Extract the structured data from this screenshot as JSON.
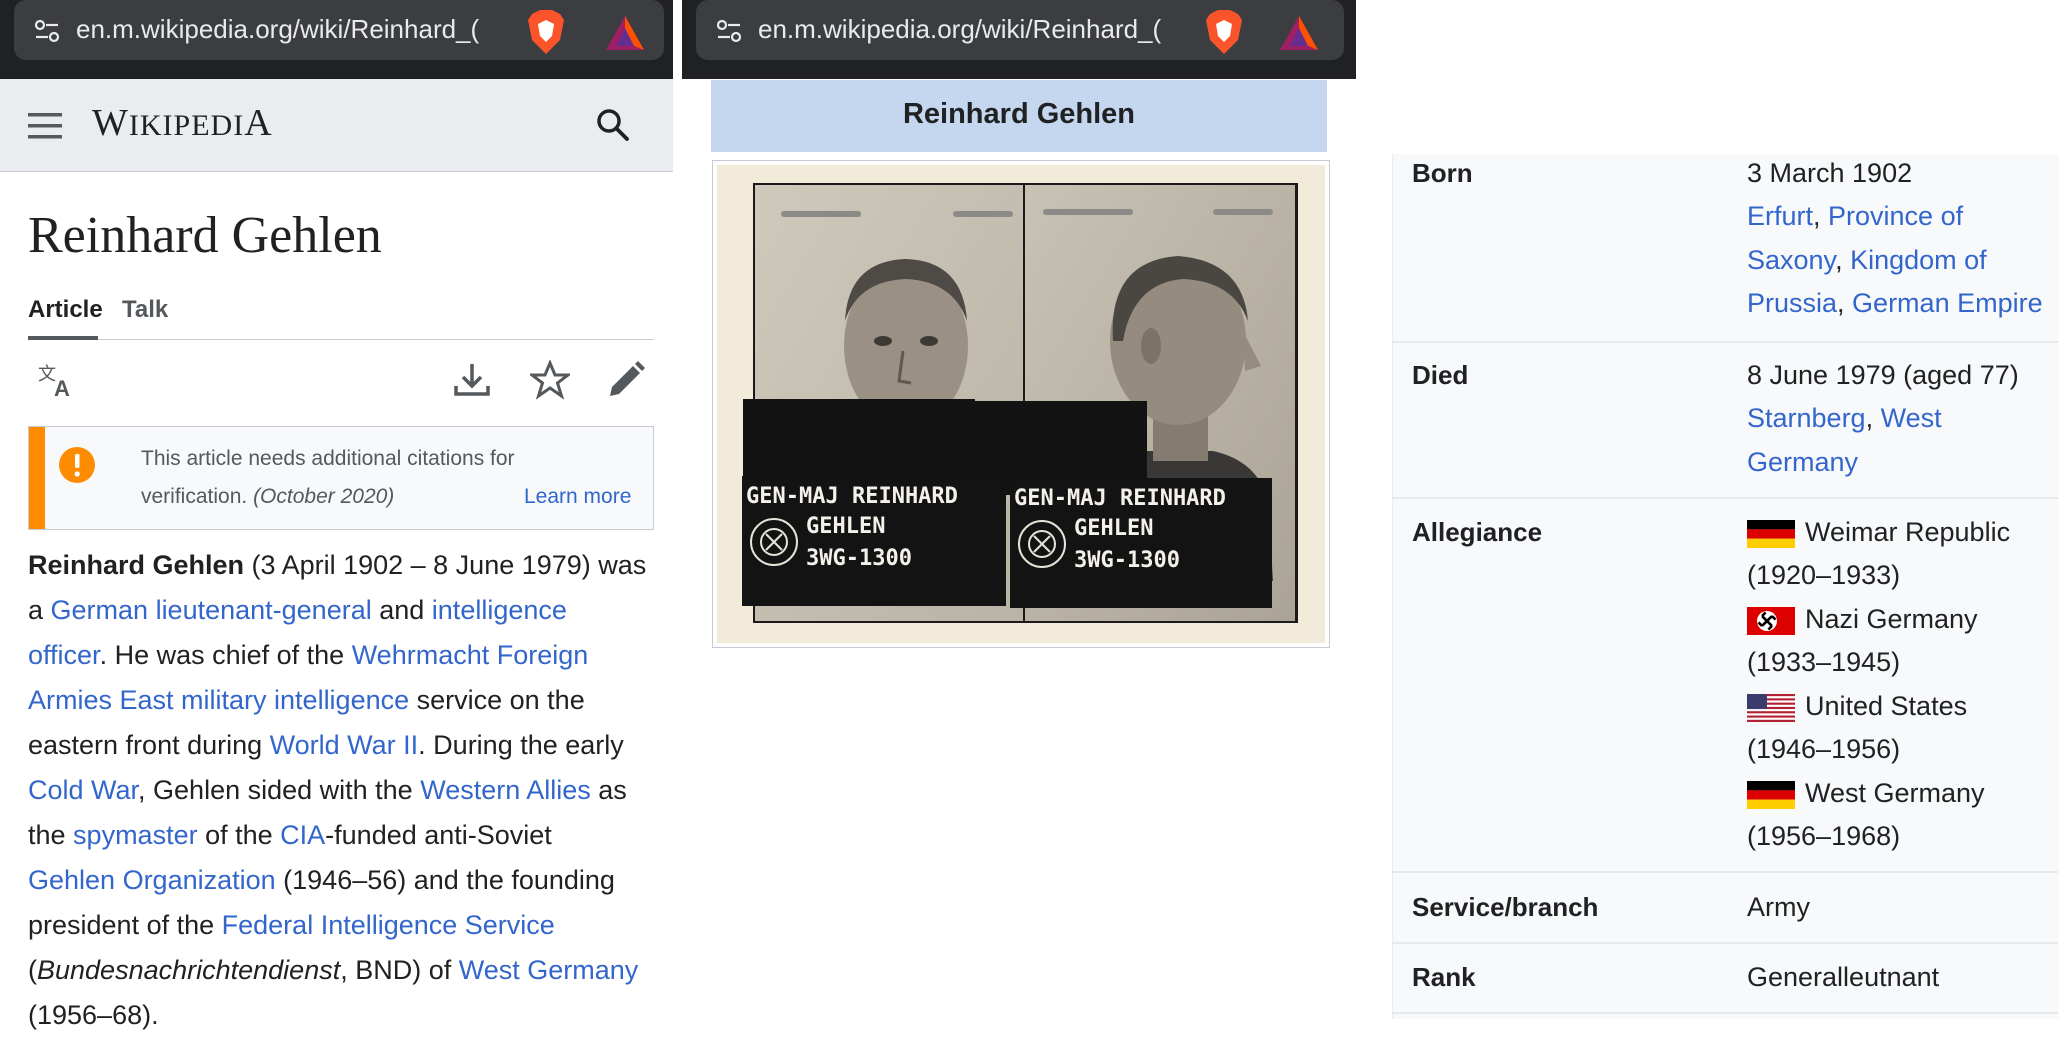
{
  "browser": {
    "url_left": "en.m.wikipedia.org/wiki/Reinhard_(",
    "url_mid": "en.m.wikipedia.org/wiki/Reinhard_("
  },
  "header": {
    "logo_big_w": "W",
    "logo_small_1": "IKIPEDI",
    "logo_big_a": "A"
  },
  "article": {
    "title": "Reinhard Gehlen",
    "tabs": [
      "Article",
      "Talk"
    ]
  },
  "notice": {
    "line1": "This article needs additional citations for",
    "line2_text": "verification.",
    "line2_date": "(October 2020)",
    "learn_more": "Learn more"
  },
  "lead": {
    "l1_bold": "Reinhard Gehlen",
    "l1_rest": " (3 April 1902 – 8 June 1979) was",
    "l2_a": "a ",
    "l2_link1": "German lieutenant-general",
    "l2_b": " and ",
    "l2_link2": "intelligence",
    "l3_link": "officer",
    "l3_b": ". He was chief of the ",
    "l3_link2": "Wehrmacht Foreign",
    "l4_link": "Armies East military intelligence",
    "l4_b": " service on the",
    "l5_a": "eastern front during ",
    "l5_link": "World War II",
    "l5_b": ". During the early",
    "l6_link": "Cold War",
    "l6_b": ", Gehlen sided with the ",
    "l6_link2": "Western Allies",
    "l6_c": " as",
    "l7_a": "the ",
    "l7_link": "spymaster",
    "l7_b": " of the ",
    "l7_link2": "CIA",
    "l7_c": "-funded anti-Soviet",
    "l8_link": "Gehlen Organization",
    "l8_b": " (1946–56) and the founding",
    "l9_a": "president of the ",
    "l9_link": "Federal Intelligence Service",
    "l10_a": "(",
    "l10_italic": "Bundesnachrichtendienst",
    "l10_b": ", BND) of ",
    "l10_link": "West Germany",
    "l11": "(1956–68)."
  },
  "infobox": {
    "caption": "Reinhard Gehlen",
    "photo_tag_left": [
      "GEN-MAJ REINHARD",
      "GEHLEN",
      "3WG-1300"
    ],
    "photo_tag_right": [
      "GEN-MAJ REINHARD",
      "GEHLEN",
      "3WG-1300"
    ],
    "born_label": "Born",
    "born_date": "3 March 1902",
    "born_l1_link1": "Erfurt",
    "born_l1_sep": ", ",
    "born_l1_link2": "Province of",
    "born_l2_link1": "Saxony",
    "born_l2_sep": ", ",
    "born_l2_link2": "Kingdom of",
    "born_l3_link1": "Prussia",
    "born_l3_sep": ", ",
    "born_l3_link2": "German Empire",
    "died_label": "Died",
    "died_date": "8 June 1979 (aged 77)",
    "died_l1_link1": "Starnberg",
    "died_l1_sep": ", ",
    "died_l1_link2": "West",
    "died_l2_link": "Germany",
    "allegiance_label": "Allegiance",
    "allegiance": [
      {
        "name": "Weimar Republic",
        "years": "(1920–1933)",
        "flag": "weimar-flag-icon"
      },
      {
        "name": "Nazi Germany",
        "years": "(1933–1945)",
        "flag": "nazi-germany-flag-icon"
      },
      {
        "name": "United States",
        "years": "(1946–1956)",
        "flag": "us-flag-icon"
      },
      {
        "name": "West Germany",
        "years": "(1956–1968)",
        "flag": "west-germany-flag-icon"
      }
    ],
    "service_label": "Service/branch",
    "service_value": "Army",
    "rank_label": "Rank",
    "rank_value": "Generalleutnant"
  },
  "colors": {
    "link": "#3366cc",
    "notice_accent": "#ff8c00",
    "caption_bg": "#c5d6ef"
  }
}
